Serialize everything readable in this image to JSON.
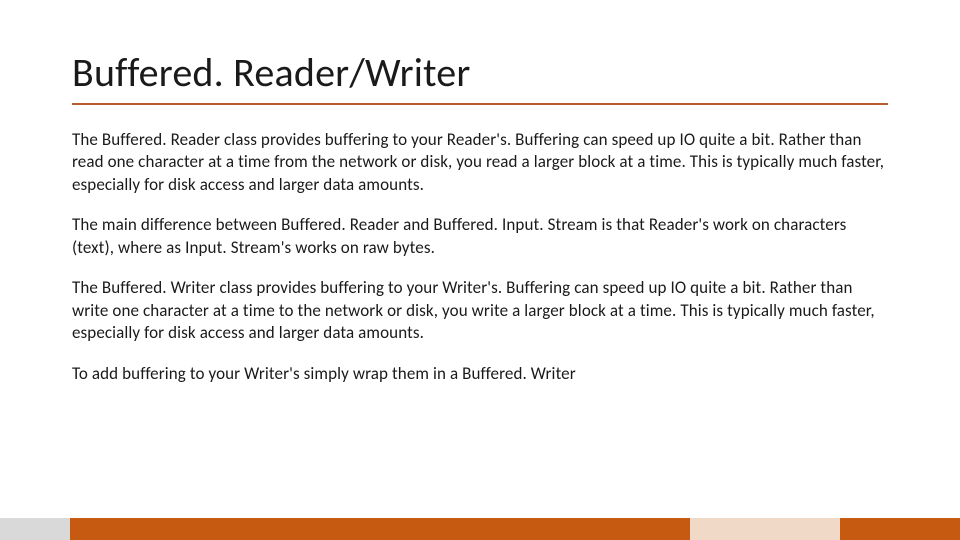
{
  "slide": {
    "title": "Buffered. Reader/Writer",
    "paragraphs": [
      "The Buffered. Reader class provides buffering to your Reader's. Buffering can speed up IO quite a bit. Rather than read one character at a time from the network or disk, you read a larger block at a time. This is typically much faster, especially for disk access and larger data amounts.",
      "The main difference between Buffered. Reader and Buffered. Input. Stream is that Reader's work on characters (text), where as Input. Stream's works on raw bytes.",
      "The Buffered. Writer class provides buffering to your Writer's. Buffering can speed up IO quite a bit. Rather than write one character at a time to the network or disk, you write a larger block at a time. This is typically much faster, especially for disk access and larger data amounts.",
      "To add buffering to your Writer's simply wrap them in a Buffered. Writer"
    ]
  },
  "theme": {
    "accent": "#c65a11",
    "underline": "#b85a2a"
  }
}
